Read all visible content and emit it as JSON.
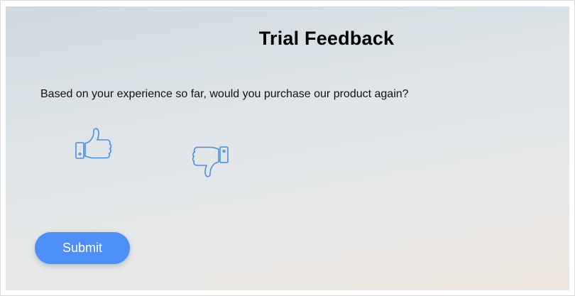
{
  "form": {
    "title": "Trial Feedback",
    "question": "Based on your experience so far, would you purchase our product again?",
    "options": [
      {
        "icon": "thumbs-up-icon"
      },
      {
        "icon": "thumbs-down-icon"
      }
    ],
    "submit_label": "Submit"
  },
  "colors": {
    "accent": "#4e8ef7",
    "icon_stroke": "#4a8fe0"
  }
}
